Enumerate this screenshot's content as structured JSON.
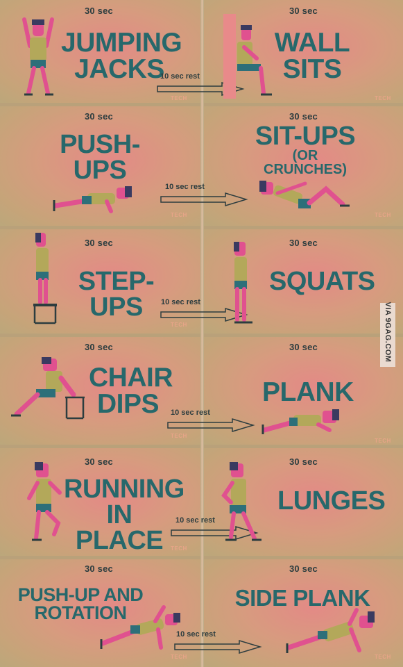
{
  "rest_label": "10 sec rest",
  "watermark": "TECH",
  "credit": "VIA 9GAG.COM",
  "exercises": [
    {
      "duration": "30 sec",
      "line1": "JUMPING",
      "line2": "JACKS",
      "icon": "jumping-jacks-figure-icon"
    },
    {
      "duration": "30 sec",
      "line1": "WALL",
      "line2": "SITS",
      "icon": "wall-sit-figure-icon"
    },
    {
      "duration": "30 sec",
      "line1": "PUSH-UPS",
      "line2": "",
      "icon": "push-up-figure-icon"
    },
    {
      "duration": "30 sec",
      "line1": "SIT-UPS",
      "line2": "(OR CRUNCHES)",
      "icon": "sit-up-figure-icon"
    },
    {
      "duration": "30 sec",
      "line1": "STEP-UPS",
      "line2": "",
      "icon": "step-up-figure-icon"
    },
    {
      "duration": "30 sec",
      "line1": "SQUATS",
      "line2": "",
      "icon": "squat-figure-icon"
    },
    {
      "duration": "30 sec",
      "line1": "CHAIR",
      "line2": "DIPS",
      "icon": "chair-dip-figure-icon"
    },
    {
      "duration": "30 sec",
      "line1": "PLANK",
      "line2": "",
      "icon": "plank-figure-icon"
    },
    {
      "duration": "30 sec",
      "line1": "RUNNING",
      "line2": "IN PLACE",
      "icon": "running-figure-icon"
    },
    {
      "duration": "30 sec",
      "line1": "LUNGES",
      "line2": "",
      "icon": "lunge-figure-icon"
    },
    {
      "duration": "30 sec",
      "line1": "PUSH-UP AND",
      "line2": "ROTATION",
      "icon": "push-up-rotation-figure-icon"
    },
    {
      "duration": "30 sec",
      "line1": "SIDE PLANK",
      "line2": "",
      "icon": "side-plank-figure-icon"
    }
  ],
  "colors": {
    "title": "#27686b",
    "skin": "#e0518f",
    "shirt": "#b3a85a",
    "shorts": "#2d6f79",
    "hair": "#3a3a60"
  }
}
